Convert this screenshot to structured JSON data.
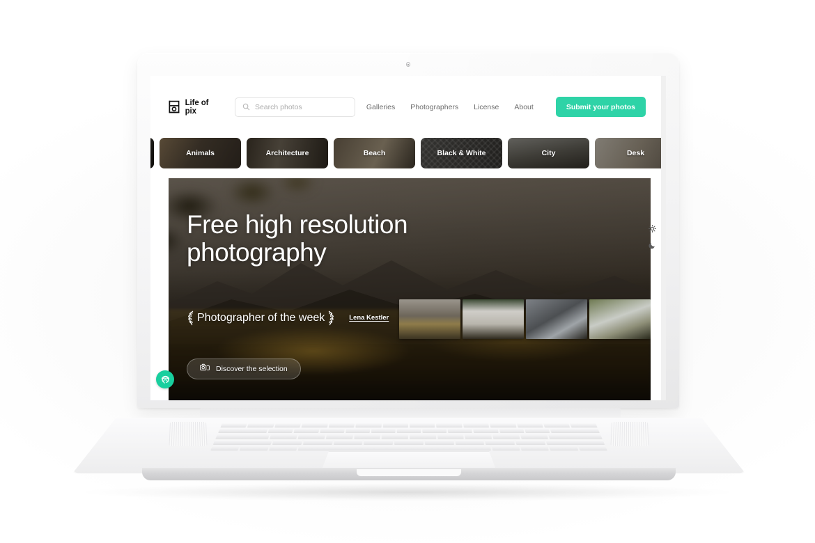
{
  "device": {
    "type": "laptop-mockup",
    "webcam": "webcam-dot"
  },
  "site": {
    "brand_name": "Life of pix",
    "logo_icon": "camera-logo-icon",
    "accent_color": "#2ed3a7"
  },
  "search": {
    "placeholder": "Search photos",
    "value": "",
    "icon": "search-icon"
  },
  "nav": {
    "links": [
      {
        "label": "Galleries"
      },
      {
        "label": "Photographers"
      },
      {
        "label": "License"
      },
      {
        "label": "About"
      }
    ],
    "cta_label": "Submit your photos"
  },
  "categories": [
    {
      "label": "",
      "partial": true,
      "texture": "tx-night"
    },
    {
      "label": "Animals",
      "partial": false,
      "texture": "tx-animals"
    },
    {
      "label": "Architecture",
      "partial": false,
      "texture": "tx-arch"
    },
    {
      "label": "Beach",
      "partial": false,
      "texture": "tx-beach"
    },
    {
      "label": "Black & White",
      "partial": false,
      "texture": "tx-bw"
    },
    {
      "label": "City",
      "partial": false,
      "texture": "tx-city"
    },
    {
      "label": "Desk",
      "partial": false,
      "texture": "tx-desk"
    },
    {
      "label": "",
      "partial": true,
      "texture": "tx-dark"
    }
  ],
  "hero": {
    "title_line_1": "Free high resolution",
    "title_line_2": "photography",
    "photographer_of_the_week_label": "Photographer of the week",
    "photographer_name": "Lena Kestler",
    "laurel_icon": "laurel-wreath-icon",
    "discover_label": "Discover the selection",
    "discover_icon": "camera-photos-icon",
    "thumbnails": [
      {
        "name": "thumbnail-mountain-field"
      },
      {
        "name": "thumbnail-snowy-peaks"
      },
      {
        "name": "thumbnail-rocky-cliff"
      },
      {
        "name": "thumbnail-caravan-forest"
      }
    ]
  },
  "theme_switch": {
    "light_icon": "sun-icon",
    "dark_icon": "moon-icon"
  },
  "privacy_badge": {
    "icon": "fingerprint-icon"
  }
}
